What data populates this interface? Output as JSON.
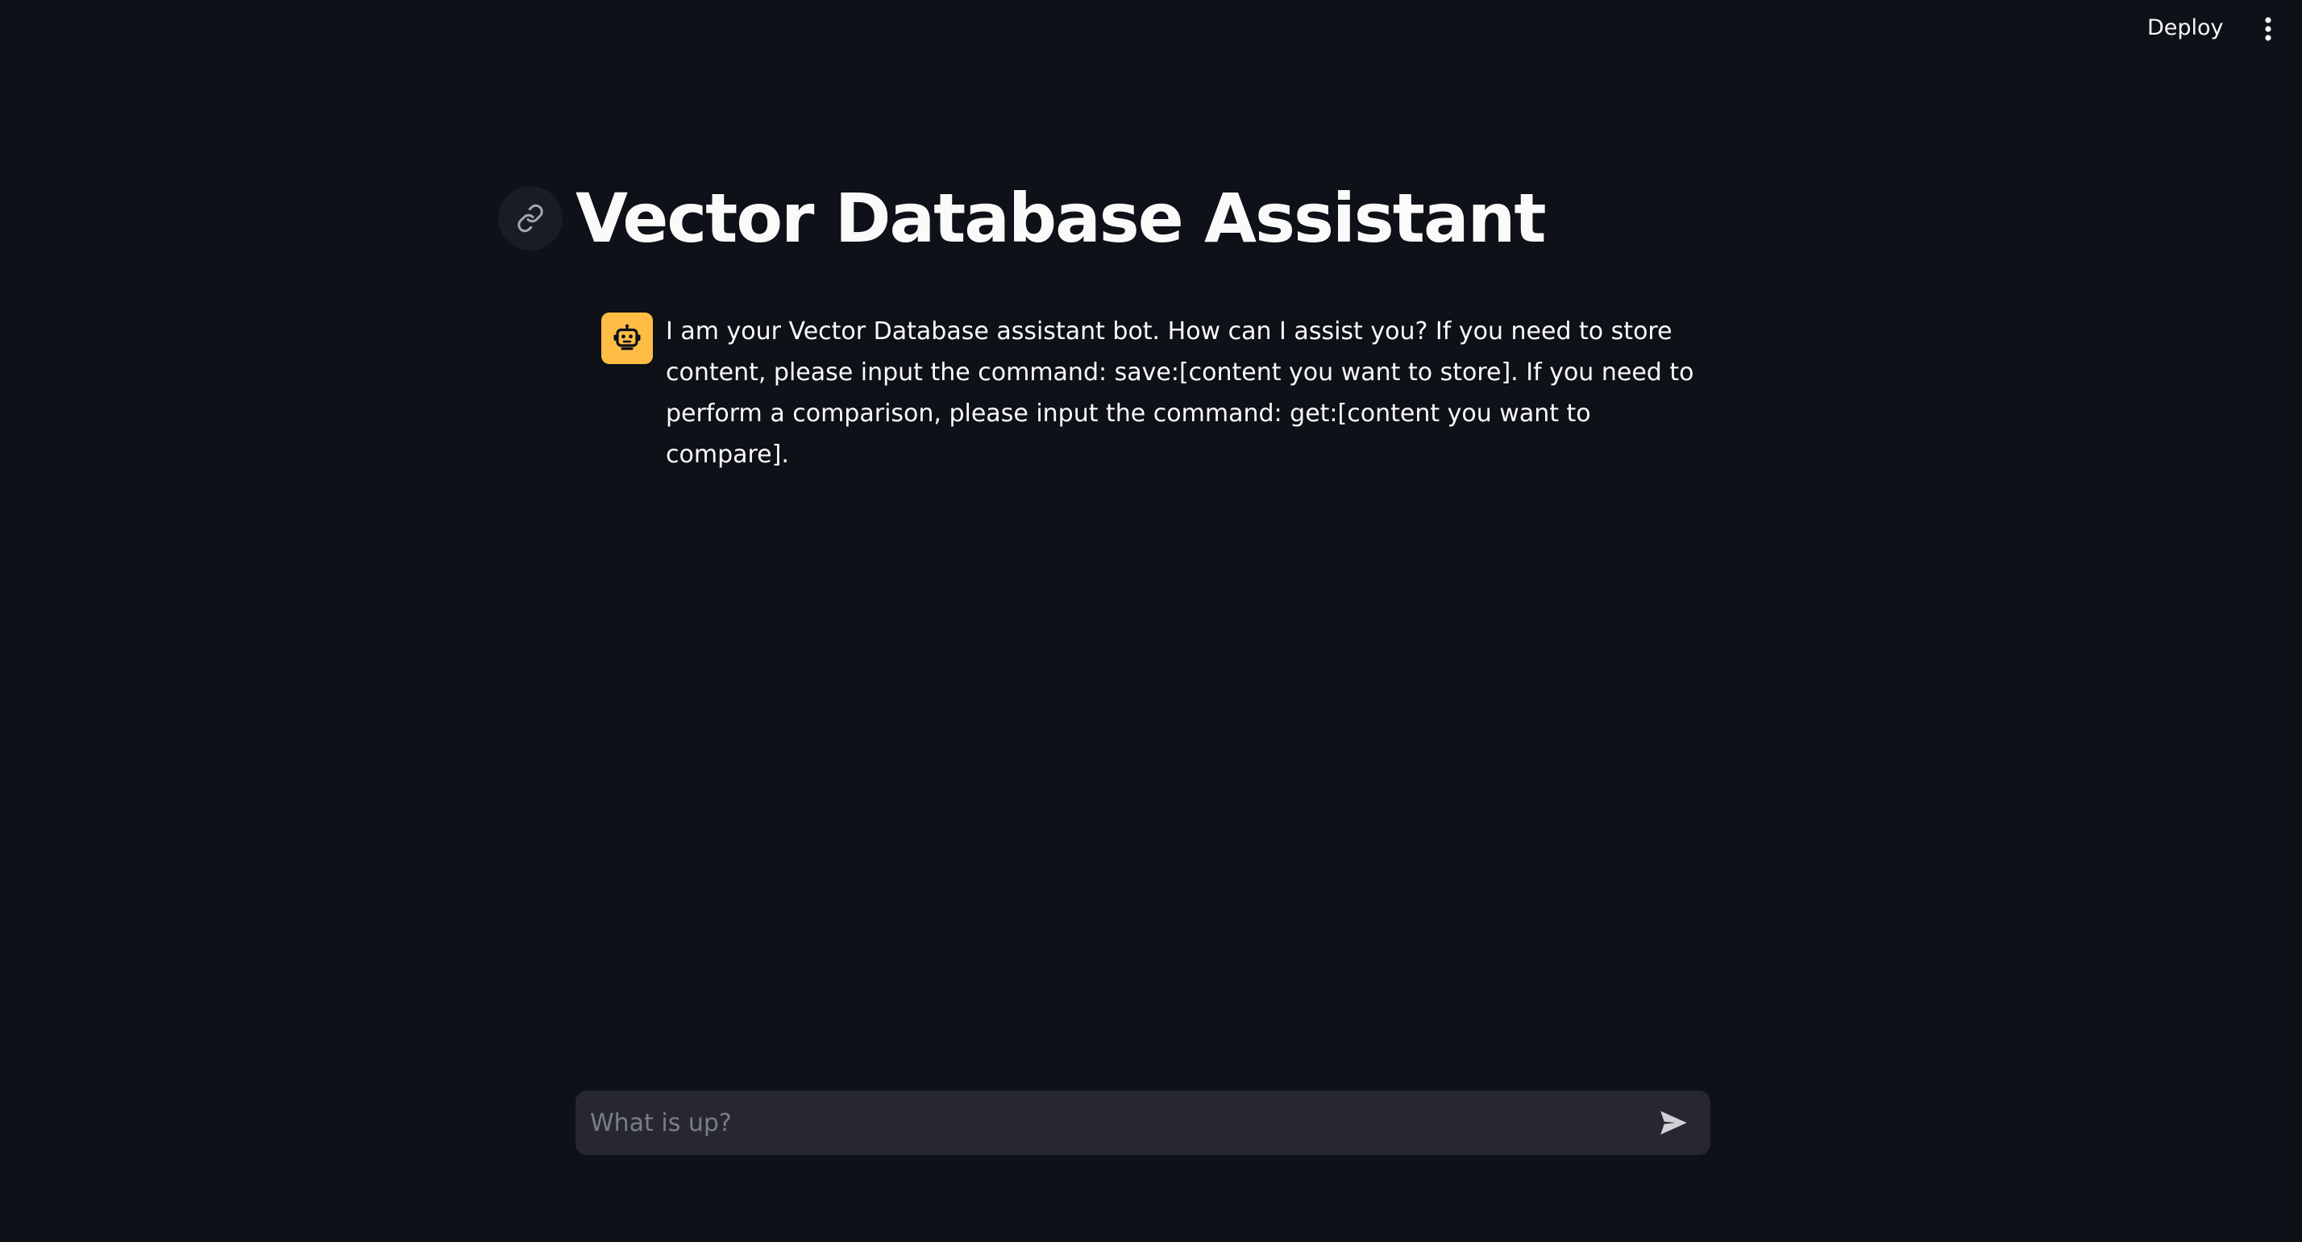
{
  "header": {
    "deploy_label": "Deploy",
    "menu_icon": "vertical-dots-icon"
  },
  "main": {
    "title": "Vector Database Assistant",
    "anchor_icon": "link-icon"
  },
  "chat": {
    "messages": [
      {
        "role": "assistant",
        "avatar_icon": "robot-icon",
        "text": "I am your Vector Database assistant bot. How can I assist you? If you need to store content, please input the command: save:[content you want to store]. If you need to perform a comparison, please input the command: get:[content you want to compare]."
      }
    ]
  },
  "input": {
    "placeholder": "What is up?",
    "value": "",
    "send_icon": "send-icon"
  },
  "colors": {
    "background": "#0e1117",
    "avatar_bg": "#ffbd45",
    "input_bg": "#262730",
    "text": "#fafafa",
    "muted": "#7b7d86"
  }
}
